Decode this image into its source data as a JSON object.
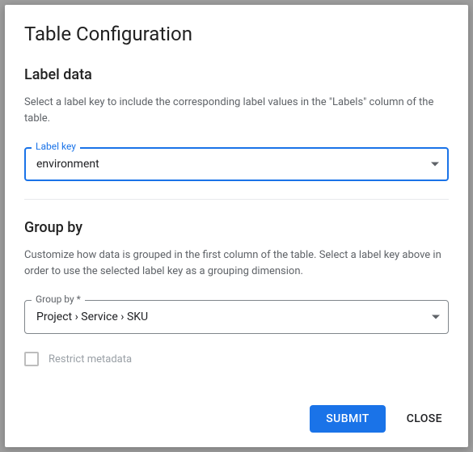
{
  "dialog": {
    "title": "Table Configuration"
  },
  "labelData": {
    "heading": "Label data",
    "description": "Select a label key to include the corresponding label values in the \"Labels\" column of the table.",
    "fieldLabel": "Label key",
    "value": "environment"
  },
  "groupBy": {
    "heading": "Group by",
    "description": "Customize how data is grouped in the first column of the table. Select a label key above in order to use the selected label key as a grouping dimension.",
    "fieldLabel": "Group by *",
    "value": "Project › Service › SKU"
  },
  "restrict": {
    "label": "Restrict metadata",
    "checked": false
  },
  "actions": {
    "submit": "Submit",
    "close": "Close"
  }
}
